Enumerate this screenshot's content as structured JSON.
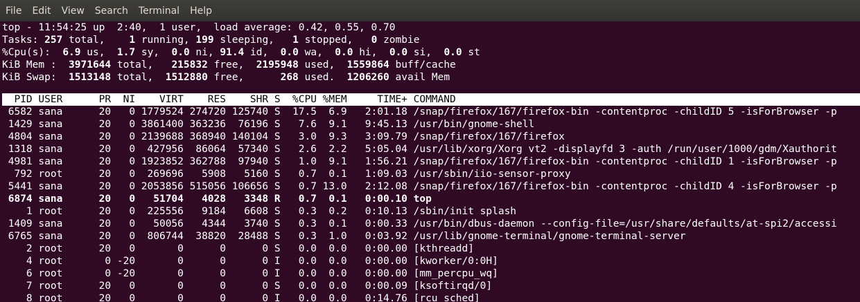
{
  "menubar": {
    "items": [
      "File",
      "Edit",
      "View",
      "Search",
      "Terminal",
      "Help"
    ]
  },
  "summary": {
    "uptime_line": "top - 11:54:25 up  2:40,  1 user,  load average: 0.42, 0.55, 0.70",
    "tasks": {
      "label": "Tasks:",
      "total": "257",
      "total_s": " total,    ",
      "running": "1",
      "running_s": " running, ",
      "sleeping": "199",
      "sleeping_s": " sleeping,   ",
      "stopped": "1",
      "stopped_s": " stopped,   ",
      "zombie": "0",
      "zombie_s": " zombie"
    },
    "cpu": {
      "label": "%Cpu(s):  ",
      "us": "6.9",
      "us_s": " us,  ",
      "sy": "1.7",
      "sy_s": " sy,  ",
      "ni": "0.0",
      "ni_s": " ni, ",
      "id": "91.4",
      "id_s": " id,  ",
      "wa": "0.0",
      "wa_s": " wa,  ",
      "hi": "0.0",
      "hi_s": " hi,  ",
      "si": "0.0",
      "si_s": " si,  ",
      "st": "0.0",
      "st_s": " st"
    },
    "mem": {
      "label": "KiB Mem :  ",
      "total": "3971644",
      "total_s": " total,   ",
      "free": "215832",
      "free_s": " free,  ",
      "used": "2195948",
      "used_s": " used,  ",
      "cache": "1559864",
      "cache_s": " buff/cache"
    },
    "swap": {
      "label": "KiB Swap:  ",
      "total": "1513148",
      "total_s": " total,  ",
      "free": "1512880",
      "free_s": " free,      ",
      "used": "268",
      "used_s": " used.  ",
      "avail": "1206260",
      "avail_s": " avail Mem"
    }
  },
  "table": {
    "header": "  PID USER      PR  NI    VIRT    RES    SHR S  %CPU %MEM     TIME+ COMMAND                                                                        ",
    "rows": [
      {
        "text": " 6582 sana      20   0 1779524 274720 125740 S  17.5  6.9   2:01.18 /snap/firefox/167/firefox-bin -contentproc -childID 5 -isForBrowser -p",
        "bold": false
      },
      {
        "text": " 1429 sana      20   0 3861400 363236  76196 S   7.6  9.1   9:45.13 /usr/bin/gnome-shell",
        "bold": false
      },
      {
        "text": " 4804 sana      20   0 2139688 368940 140104 S   3.0  9.3   3:09.79 /snap/firefox/167/firefox",
        "bold": false
      },
      {
        "text": " 1318 sana      20   0  427956  86064  57340 S   2.6  2.2   5:05.04 /usr/lib/xorg/Xorg vt2 -displayfd 3 -auth /run/user/1000/gdm/Xauthorit",
        "bold": false
      },
      {
        "text": " 4981 sana      20   0 1923852 362788  97940 S   1.0  9.1   1:56.21 /snap/firefox/167/firefox-bin -contentproc -childID 1 -isForBrowser -p",
        "bold": false
      },
      {
        "text": "  792 root      20   0  269696   5908   5160 S   0.7  0.1   1:09.03 /usr/sbin/iio-sensor-proxy",
        "bold": false
      },
      {
        "text": " 5441 sana      20   0 2053856 515056 106656 S   0.7 13.0   2:12.08 /snap/firefox/167/firefox-bin -contentproc -childID 4 -isForBrowser -p",
        "bold": false
      },
      {
        "text": " 6874 sana      20   0   51704   4028   3348 R   0.7  0.1   0:00.10 top",
        "bold": true
      },
      {
        "text": "    1 root      20   0  225556   9184   6608 S   0.3  0.2   0:10.13 /sbin/init splash",
        "bold": false
      },
      {
        "text": " 1409 sana      20   0   50056   4344   3740 S   0.3  0.1   0:00.33 /usr/bin/dbus-daemon --config-file=/usr/share/defaults/at-spi2/accessi",
        "bold": false
      },
      {
        "text": " 6765 sana      20   0  806744  38820  28488 S   0.3  1.0   0:03.92 /usr/lib/gnome-terminal/gnome-terminal-server",
        "bold": false
      },
      {
        "text": "    2 root      20   0       0      0      0 S   0.0  0.0   0:00.00 [kthreadd]",
        "bold": false
      },
      {
        "text": "    4 root       0 -20       0      0      0 I   0.0  0.0   0:00.00 [kworker/0:0H]",
        "bold": false
      },
      {
        "text": "    6 root       0 -20       0      0      0 I   0.0  0.0   0:00.00 [mm_percpu_wq]",
        "bold": false
      },
      {
        "text": "    7 root      20   0       0      0      0 S   0.0  0.0   0:00.09 [ksoftirqd/0]",
        "bold": false
      },
      {
        "text": "    8 root      20   0       0      0      0 I   0.0  0.0   0:14.76 [rcu_sched]",
        "bold": false
      }
    ]
  }
}
